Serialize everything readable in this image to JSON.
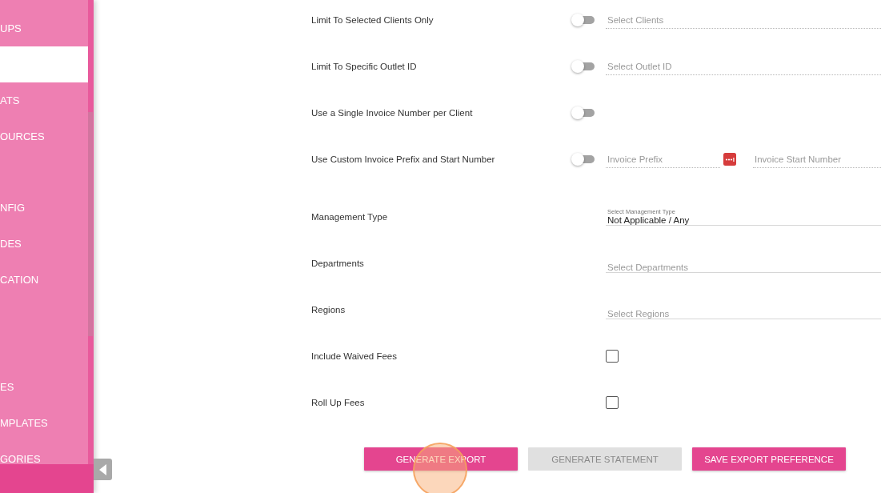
{
  "sidebar": {
    "items": [
      {
        "label": "UPS",
        "selected": false
      },
      {
        "selected": true
      },
      {
        "label": "ATS",
        "selected": false
      },
      {
        "label": "OURCES",
        "selected": false
      },
      {
        "selected": false
      },
      {
        "label": "NFIG",
        "selected": false
      },
      {
        "label": "DES",
        "selected": false
      },
      {
        "label": "CATION",
        "selected": false
      },
      {
        "selected": false
      },
      {
        "selected": false
      },
      {
        "label": "ES",
        "selected": false
      },
      {
        "label": "MPLATES",
        "selected": false
      },
      {
        "label": "GORIES",
        "selected": false
      }
    ]
  },
  "form": {
    "rows": [
      {
        "kind": "switch",
        "label": "Limit To Selected Clients Only",
        "on": false,
        "fields": [
          {
            "placeholder": "Select Clients",
            "disabled": true
          }
        ]
      },
      {
        "kind": "switch",
        "label": "Limit To Specific Outlet ID",
        "on": false,
        "fields": [
          {
            "placeholder": "Select Outlet ID",
            "disabled": true
          }
        ]
      },
      {
        "kind": "switch",
        "label": "Use a Single Invoice Number per Client",
        "on": false
      },
      {
        "kind": "switch",
        "label": "Use Custom Invoice Prefix and Start Number",
        "on": false,
        "fields": [
          {
            "placeholder": "Invoice Prefix",
            "disabled": true
          },
          {
            "placeholder": "Invoice Start Number",
            "disabled": true
          }
        ]
      },
      {
        "kind": "select",
        "label": "Management Type",
        "field": {
          "label": "Select Management Type",
          "value": "Not Applicable / Any",
          "disabled": false
        }
      },
      {
        "kind": "select",
        "label": "Departments",
        "field": {
          "placeholder": "Select Departments",
          "disabled": false
        }
      },
      {
        "kind": "select",
        "label": "Regions",
        "field": {
          "placeholder": "Select Regions",
          "disabled": false
        }
      },
      {
        "kind": "checkbox",
        "label": "Include Waived Fees",
        "checked": false
      },
      {
        "kind": "checkbox",
        "label": "Roll Up Fees",
        "checked": false
      }
    ]
  },
  "buttons": [
    {
      "label": "GENERATE EXPORT",
      "disabled": false
    },
    {
      "label": "GENERATE STATEMENT",
      "disabled": true
    },
    {
      "label": "SAVE EXPORT PREFERENCE",
      "disabled": false
    }
  ]
}
